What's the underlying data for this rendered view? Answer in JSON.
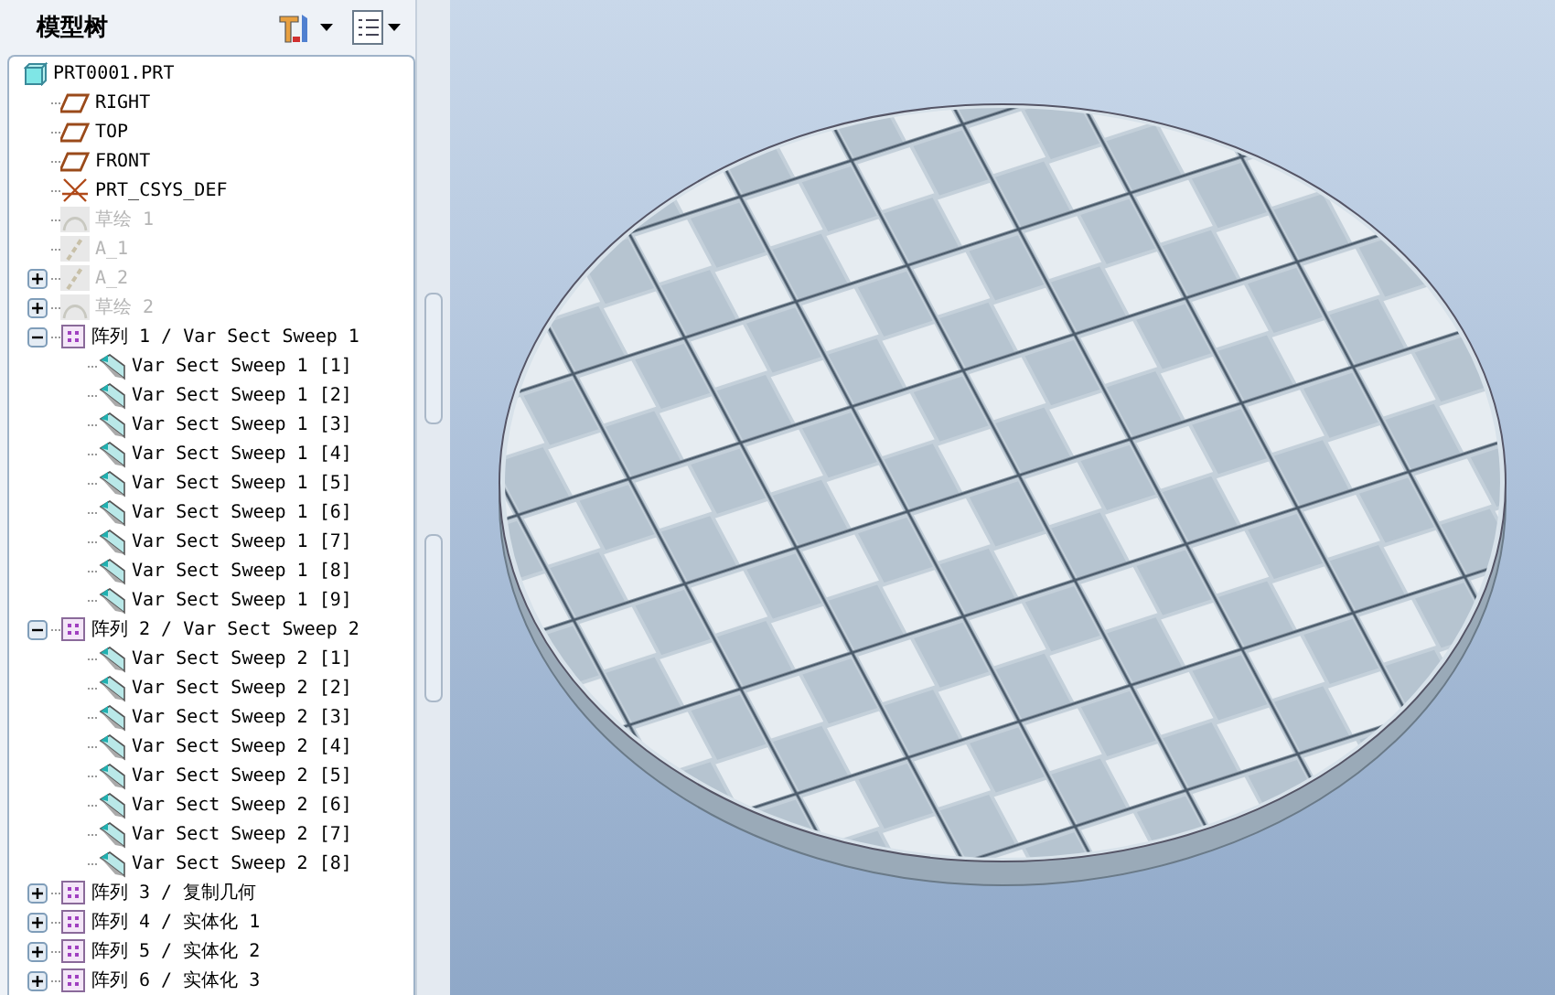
{
  "panel": {
    "title": "模型树"
  },
  "tree": {
    "label": "PRT0001.PRT",
    "kind": "part",
    "children": [
      {
        "label": "RIGHT",
        "kind": "plane",
        "suppressed": false
      },
      {
        "label": "TOP",
        "kind": "plane",
        "suppressed": false
      },
      {
        "label": "FRONT",
        "kind": "plane",
        "suppressed": false
      },
      {
        "label": "PRT_CSYS_DEF",
        "kind": "csys",
        "suppressed": false
      },
      {
        "label": "草绘 1",
        "kind": "sketch",
        "suppressed": true
      },
      {
        "label": "A_1",
        "kind": "axis",
        "suppressed": true
      },
      {
        "label": "A_2",
        "kind": "axis",
        "suppressed": true,
        "expanded": false
      },
      {
        "label": "草绘 2",
        "kind": "sketch",
        "suppressed": true,
        "expanded": false
      },
      {
        "label": "阵列 1 / Var Sect Sweep 1",
        "kind": "pattern",
        "suppressed": false,
        "expanded": true,
        "children": [
          {
            "label": "Var Sect Sweep 1 [1]",
            "kind": "sweep",
            "suppressed": false
          },
          {
            "label": "Var Sect Sweep 1 [2]",
            "kind": "sweep",
            "suppressed": false
          },
          {
            "label": "Var Sect Sweep 1 [3]",
            "kind": "sweep",
            "suppressed": false
          },
          {
            "label": "Var Sect Sweep 1 [4]",
            "kind": "sweep",
            "suppressed": false
          },
          {
            "label": "Var Sect Sweep 1 [5]",
            "kind": "sweep",
            "suppressed": false
          },
          {
            "label": "Var Sect Sweep 1 [6]",
            "kind": "sweep",
            "suppressed": false
          },
          {
            "label": "Var Sect Sweep 1 [7]",
            "kind": "sweep",
            "suppressed": false
          },
          {
            "label": "Var Sect Sweep 1 [8]",
            "kind": "sweep",
            "suppressed": false
          },
          {
            "label": "Var Sect Sweep 1 [9]",
            "kind": "sweep",
            "suppressed": false
          }
        ]
      },
      {
        "label": "阵列 2 / Var Sect Sweep 2",
        "kind": "pattern",
        "suppressed": false,
        "expanded": true,
        "children": [
          {
            "label": "Var Sect Sweep 2 [1]",
            "kind": "sweep",
            "suppressed": false
          },
          {
            "label": "Var Sect Sweep 2 [2]",
            "kind": "sweep",
            "suppressed": false
          },
          {
            "label": "Var Sect Sweep 2 [3]",
            "kind": "sweep",
            "suppressed": false
          },
          {
            "label": "Var Sect Sweep 2 [4]",
            "kind": "sweep",
            "suppressed": false
          },
          {
            "label": "Var Sect Sweep 2 [5]",
            "kind": "sweep",
            "suppressed": false
          },
          {
            "label": "Var Sect Sweep 2 [6]",
            "kind": "sweep",
            "suppressed": false
          },
          {
            "label": "Var Sect Sweep 2 [7]",
            "kind": "sweep",
            "suppressed": false
          },
          {
            "label": "Var Sect Sweep 2 [8]",
            "kind": "sweep",
            "suppressed": false
          }
        ]
      },
      {
        "label": "阵列 3 / 复制几何",
        "kind": "pattern",
        "suppressed": false,
        "expanded": false
      },
      {
        "label": "阵列 4 / 实体化 1",
        "kind": "pattern",
        "suppressed": false,
        "expanded": false
      },
      {
        "label": "阵列 5 / 实体化 2",
        "kind": "pattern",
        "suppressed": false,
        "expanded": false
      },
      {
        "label": "阵列 6 / 实体化 3",
        "kind": "pattern",
        "suppressed": false,
        "expanded": false
      }
    ]
  }
}
